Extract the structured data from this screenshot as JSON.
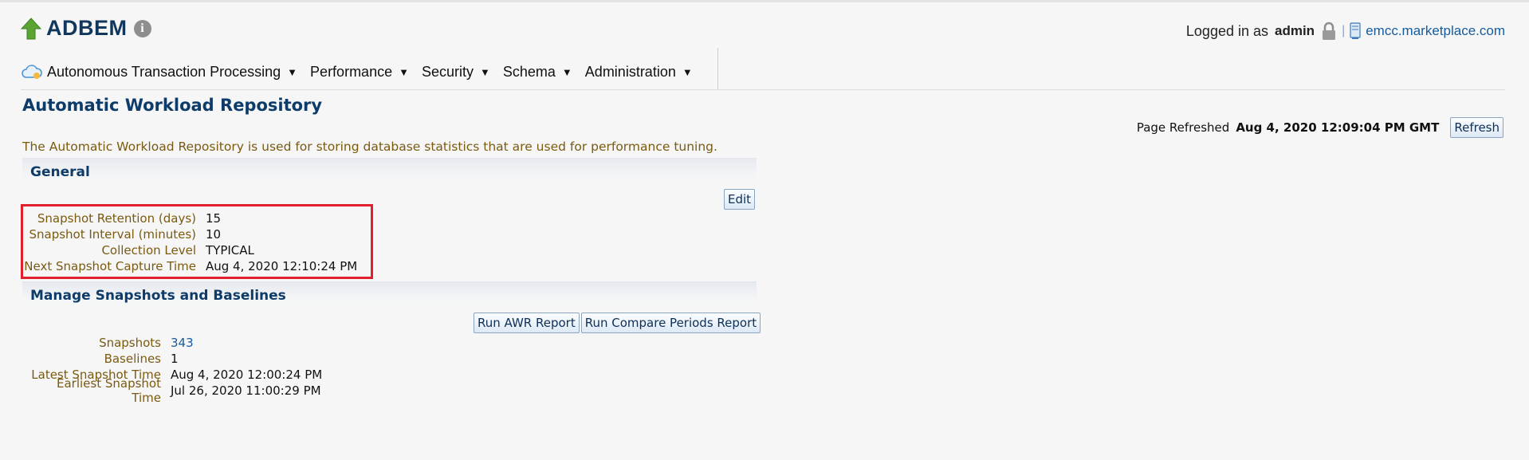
{
  "header": {
    "title": "ADBEM",
    "logged_in_prefix": "Logged in as",
    "username": "admin",
    "host_link": "emcc.marketplace.com"
  },
  "nav": {
    "items": [
      {
        "label": "Autonomous Transaction Processing"
      },
      {
        "label": "Performance"
      },
      {
        "label": "Security"
      },
      {
        "label": "Schema"
      },
      {
        "label": "Administration"
      }
    ]
  },
  "page": {
    "title": "Automatic Workload Repository",
    "description": "The Automatic Workload Repository is used for storing database statistics that are used for performance tuning.",
    "refreshed_label": "Page Refreshed",
    "refreshed_time": "Aug 4, 2020 12:09:04 PM GMT",
    "refresh_button": "Refresh"
  },
  "general": {
    "heading": "General",
    "edit_button": "Edit",
    "rows": [
      {
        "label": "Snapshot Retention (days)",
        "value": "15"
      },
      {
        "label": "Snapshot Interval (minutes)",
        "value": "10"
      },
      {
        "label": "Collection Level",
        "value": "TYPICAL"
      },
      {
        "label": "Next Snapshot Capture Time",
        "value": "Aug 4, 2020 12:10:24 PM"
      }
    ]
  },
  "manage": {
    "heading": "Manage Snapshots and Baselines",
    "run_awr_button": "Run AWR Report",
    "run_compare_button": "Run Compare Periods Report",
    "rows": [
      {
        "label": "Snapshots",
        "value": "343"
      },
      {
        "label": "Baselines",
        "value": "1"
      },
      {
        "label": "Latest Snapshot Time",
        "value": "Aug 4, 2020 12:00:24 PM"
      },
      {
        "label": "Earliest Snapshot Time",
        "value": "Jul 26, 2020 11:00:29 PM"
      }
    ]
  },
  "colors": {
    "title": "#11375c",
    "label": "#7a5a10",
    "link": "#145c9e",
    "highlight": "#e0202c"
  }
}
